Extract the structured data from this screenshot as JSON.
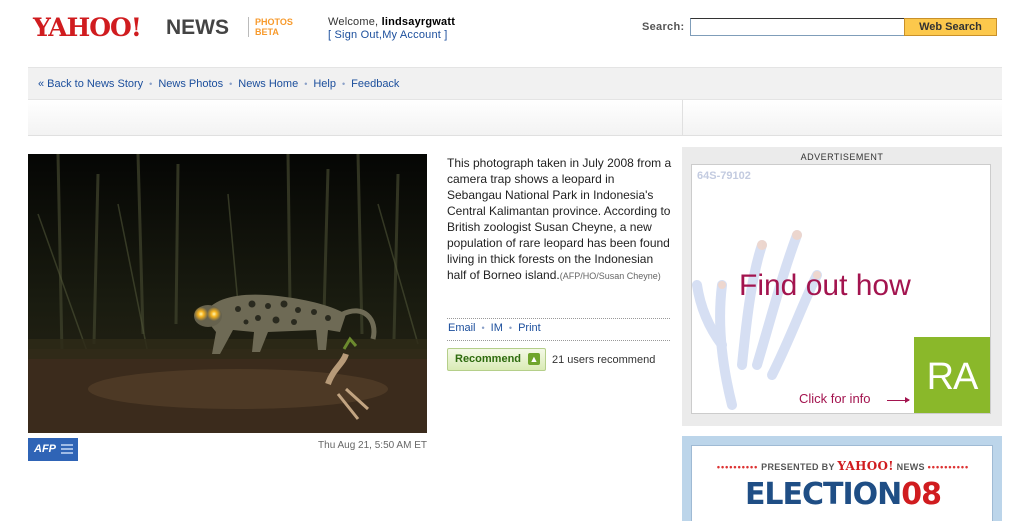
{
  "header": {
    "logo_text": "YAHOO!",
    "logo_section": "NEWS",
    "photos_label": "PHOTOS",
    "beta_label": "BETA",
    "welcome_prefix": "Welcome,",
    "username": "lindsayrgwatt",
    "sign_out": "Sign Out",
    "my_account": "My Account",
    "search_label": "Search:",
    "search_value": "",
    "search_button": "Web Search"
  },
  "nav": {
    "items": [
      "« Back to News Story",
      "News Photos",
      "News Home",
      "Help",
      "Feedback"
    ]
  },
  "photo": {
    "caption": "This photograph taken in July 2008 from a camera trap shows a leopard in Sebangau National Park in Indonesia's Central Kalimantan province. According to British zoologist Susan Cheyne, a new population of rare leopard has been found living in thick forests on the Indonesian half of Borneo island.",
    "credit": "(AFP/HO/Susan Cheyne)",
    "source_logo": "AFP",
    "timestamp": "Thu Aug 21, 5:50 AM ET"
  },
  "actions": {
    "email": "Email",
    "im": "IM",
    "print": "Print",
    "recommend_button": "Recommend",
    "recommend_count": "21 users recommend"
  },
  "ad": {
    "label": "ADVERTISEMENT",
    "code": "64S-79102",
    "headline": "Find out how",
    "click_text": "Click for info",
    "brand": "RA"
  },
  "election": {
    "presented_by": "PRESENTED BY",
    "yahoo": "YAHOO!",
    "news": "NEWS",
    "title_word": "ELECTION",
    "title_year": "08"
  },
  "colors": {
    "yahoo_red": "#d01c1f",
    "link_blue": "#1b4e9c",
    "search_button": "#fcc84c",
    "ad_magenta": "#a3144f",
    "ad_green": "#8ab82a",
    "election_blue": "#1f4e85"
  }
}
